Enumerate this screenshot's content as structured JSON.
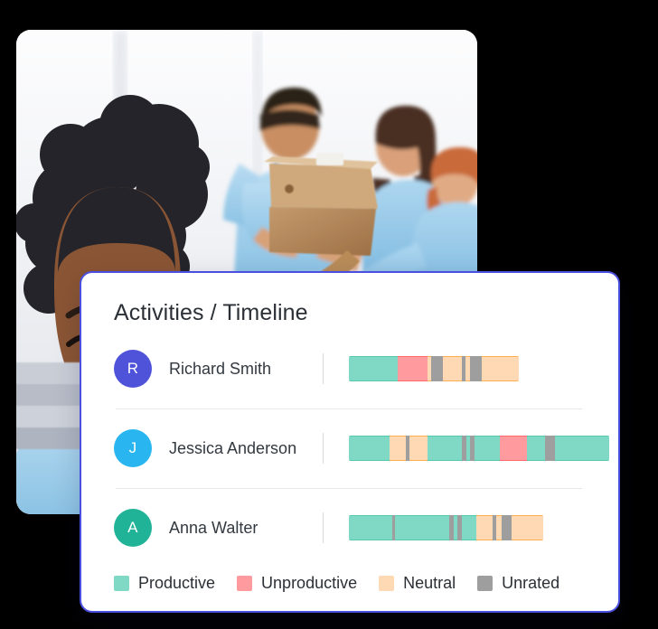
{
  "photo": {
    "alt": "Team of volunteers in light blue shirts packing a cardboard box, smiling woman in foreground"
  },
  "card": {
    "title": "Activities / Timeline",
    "border_color": "#4a4fe0"
  },
  "colors": {
    "productive": "#7fd9c4",
    "unproductive": "#ff9a9e",
    "neutral": "#ffd9b3",
    "unrated": "#9e9e9e",
    "productive_border": "#55c9ae",
    "unproductive_border": "#ff6b6b",
    "neutral_border": "#ffad52",
    "unrated_border": "#9e9e9e"
  },
  "rows": [
    {
      "initial": "R",
      "name": "Richard Smith",
      "avatar_color": "#4f53d9",
      "segments": [
        {
          "type": "productive",
          "width": 54
        },
        {
          "type": "unproductive",
          "width": 33
        },
        {
          "type": "neutral",
          "width": 4
        },
        {
          "type": "unrated",
          "width": 13
        },
        {
          "type": "neutral",
          "width": 21
        },
        {
          "type": "unrated",
          "width": 4
        },
        {
          "type": "neutral",
          "width": 5
        },
        {
          "type": "unrated",
          "width": 13
        },
        {
          "type": "neutral",
          "width": 41
        }
      ]
    },
    {
      "initial": "J",
      "name": "Jessica Anderson",
      "avatar_color": "#29b6f0",
      "segments": [
        {
          "type": "productive",
          "width": 45
        },
        {
          "type": "neutral",
          "width": 18
        },
        {
          "type": "unrated",
          "width": 4
        },
        {
          "type": "neutral",
          "width": 20
        },
        {
          "type": "productive",
          "width": 38
        },
        {
          "type": "unrated",
          "width": 5
        },
        {
          "type": "productive",
          "width": 4
        },
        {
          "type": "unrated",
          "width": 5
        },
        {
          "type": "productive",
          "width": 28
        },
        {
          "type": "unproductive",
          "width": 30
        },
        {
          "type": "productive",
          "width": 20
        },
        {
          "type": "unrated",
          "width": 11
        },
        {
          "type": "productive",
          "width": 60
        }
      ]
    },
    {
      "initial": "A",
      "name": "Anna Walter",
      "avatar_color": "#21b397",
      "segments": [
        {
          "type": "productive",
          "width": 48
        },
        {
          "type": "unrated",
          "width": 3
        },
        {
          "type": "productive",
          "width": 60
        },
        {
          "type": "unrated",
          "width": 5
        },
        {
          "type": "productive",
          "width": 4
        },
        {
          "type": "unrated",
          "width": 5
        },
        {
          "type": "productive",
          "width": 16
        },
        {
          "type": "neutral",
          "width": 18
        },
        {
          "type": "unrated",
          "width": 4
        },
        {
          "type": "neutral",
          "width": 6
        },
        {
          "type": "unrated",
          "width": 11
        },
        {
          "type": "neutral",
          "width": 35
        }
      ]
    }
  ],
  "legend": [
    {
      "label": "Productive",
      "type": "productive"
    },
    {
      "label": "Unproductive",
      "type": "unproductive"
    },
    {
      "label": "Neutral",
      "type": "neutral"
    },
    {
      "label": "Unrated",
      "type": "unrated"
    }
  ],
  "chart_data": {
    "type": "bar",
    "title": "Activities / Timeline",
    "subtype": "stacked-horizontal-timeline",
    "legend_position": "bottom-left",
    "categories": [
      "Richard Smith",
      "Jessica Anderson",
      "Anna Walter"
    ],
    "segment_types": [
      "Productive",
      "Unproductive",
      "Neutral",
      "Unrated"
    ],
    "series": [
      {
        "name": "Richard Smith",
        "total_width": 188,
        "values": [
          54,
          33,
          4,
          13,
          21,
          4,
          5,
          13,
          41
        ]
      },
      {
        "name": "Jessica Anderson",
        "total_width": 288,
        "values": [
          45,
          18,
          4,
          20,
          38,
          5,
          4,
          5,
          28,
          30,
          20,
          11,
          60
        ]
      },
      {
        "name": "Anna Walter",
        "total_width": 215,
        "values": [
          48,
          3,
          60,
          5,
          4,
          5,
          16,
          18,
          4,
          6,
          11,
          35
        ]
      }
    ],
    "xlabel": "",
    "ylabel": "",
    "grid": false
  }
}
